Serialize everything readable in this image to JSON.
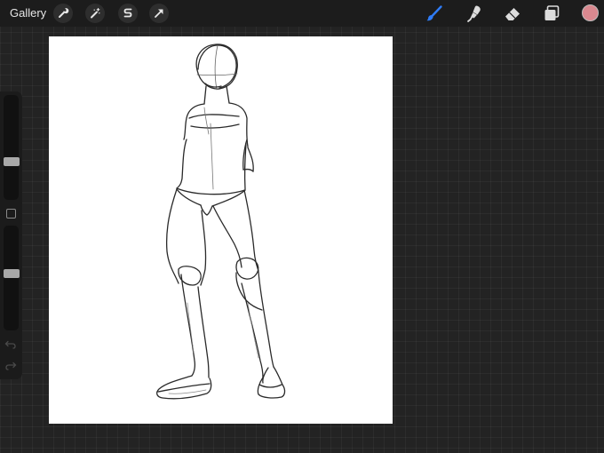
{
  "topbar": {
    "gallery_label": "Gallery",
    "left_tools": [
      {
        "name": "actions",
        "icon": "wrench-icon"
      },
      {
        "name": "adjustments",
        "icon": "magic-wand-icon"
      },
      {
        "name": "selection",
        "icon": "selection-s-icon"
      },
      {
        "name": "transform",
        "icon": "arrow-cursor-icon"
      }
    ],
    "right_tools": [
      {
        "name": "brush",
        "icon": "brush-icon",
        "active": true,
        "color": "#2f7cf6"
      },
      {
        "name": "smudge",
        "icon": "smudge-finger-icon",
        "active": false
      },
      {
        "name": "eraser",
        "icon": "eraser-icon",
        "active": false
      },
      {
        "name": "layers",
        "icon": "layers-icon",
        "active": false
      }
    ],
    "current_color": "#d9888f"
  },
  "sidebar": {
    "brush_size_level": 0.35,
    "opacity_level": 0.55,
    "modify_icon": "square-icon",
    "undo_icon": "undo-arrow-icon",
    "redo_icon": "redo-arrow-icon"
  },
  "canvas": {
    "background": "#ffffff",
    "content": "pencil-figure-sketch"
  }
}
